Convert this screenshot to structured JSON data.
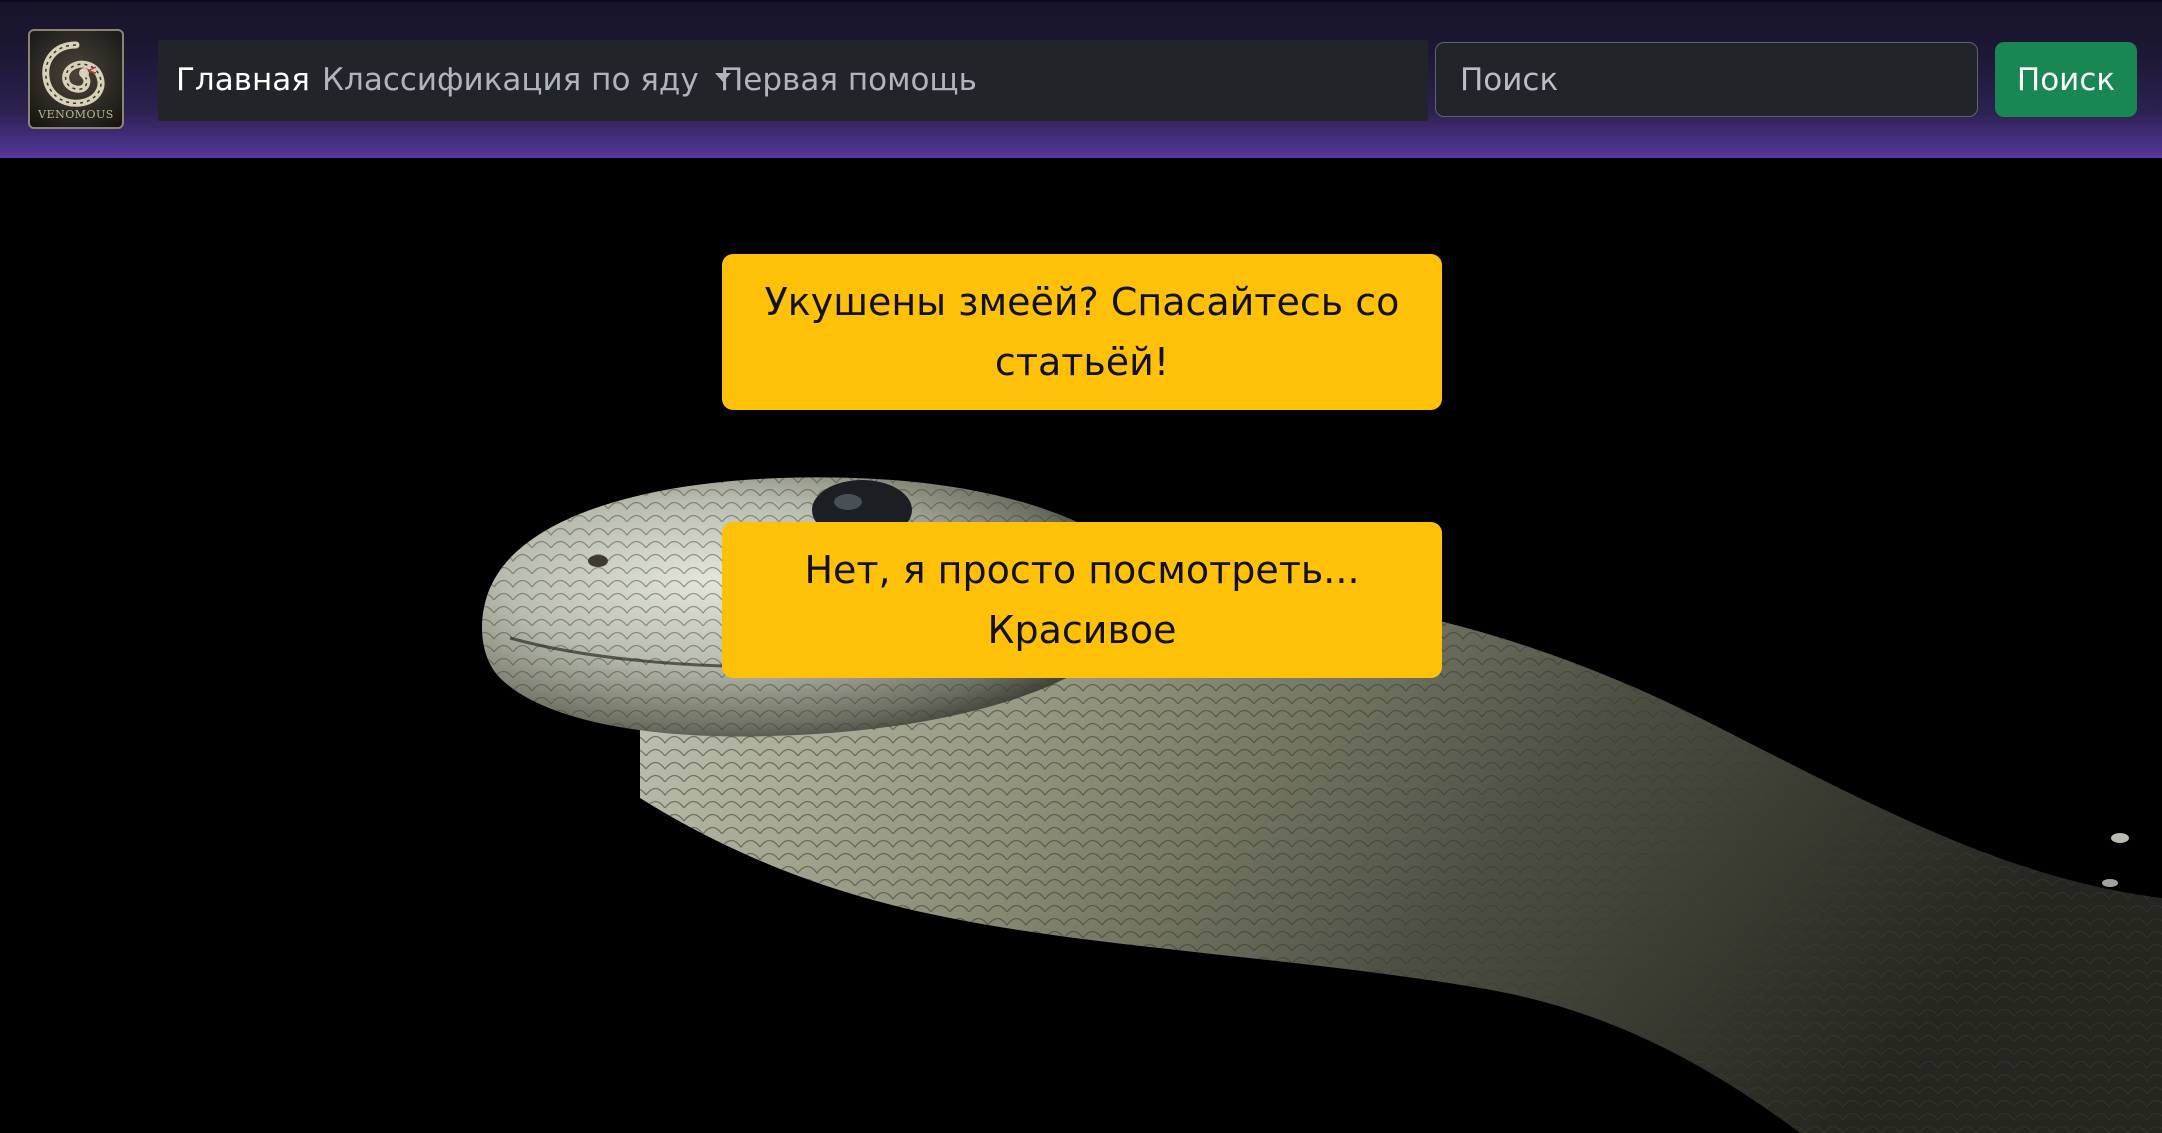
{
  "header": {
    "logo_text": "VENOMOUS",
    "nav": {
      "home_label": "Главная",
      "classification_label": "Классификация по яду",
      "first_aid_label": "Первая помощь"
    },
    "search": {
      "placeholder": "Поиск",
      "value": "",
      "button_label": "Поиск"
    }
  },
  "hero": {
    "bitten_button_label": "Укушены змеёй? Спасайтесь со статьёй!",
    "just_looking_button_label": "Нет, я просто посмотреть... Красивое"
  },
  "colors": {
    "accent_yellow": "#ffc107",
    "search_green": "#198754",
    "navbar_dark": "#212529",
    "header_purple": "#54389a"
  }
}
